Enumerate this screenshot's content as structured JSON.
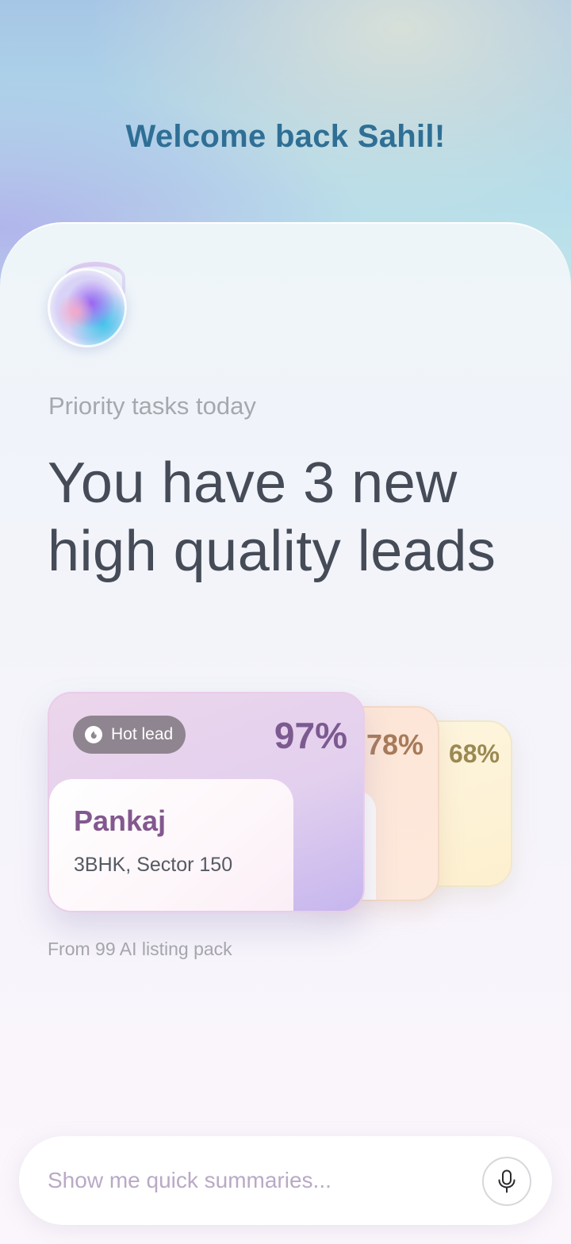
{
  "header": {
    "welcome_text": "Welcome back Sahil!"
  },
  "assistant": {
    "avatar_icon": "ai-orb-icon"
  },
  "priority": {
    "label": "Priority tasks today",
    "headline_line1": "You have 3 new",
    "headline_line2": "high quality leads"
  },
  "leads": [
    {
      "badge_label": "Hot lead",
      "badge_icon": "flame-icon",
      "score": "97%",
      "name": "Pankaj",
      "detail": "3BHK, Sector 150",
      "accent": "#7c5a90"
    },
    {
      "score": "78%",
      "accent": "#a77a59"
    },
    {
      "score": "68%",
      "accent": "#9b8952"
    }
  ],
  "source_text": "From 99 AI listing pack",
  "composer": {
    "placeholder": "Show me quick summaries...",
    "mic_icon": "microphone-icon"
  },
  "colors": {
    "title": "#2f6f95",
    "headline": "#454b57",
    "muted": "#a6a8ae"
  }
}
